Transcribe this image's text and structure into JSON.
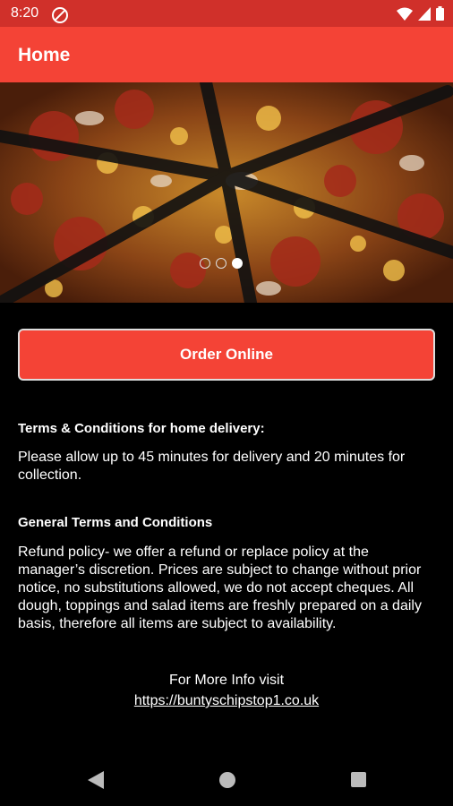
{
  "status_bar": {
    "time": "8:20",
    "icons": [
      "do-not-disturb-icon",
      "wifi-icon",
      "signal-icon",
      "battery-icon"
    ]
  },
  "app_bar": {
    "title": "Home"
  },
  "carousel": {
    "image": "pizza-photo",
    "pages": 3,
    "active_index": 2
  },
  "order_button": {
    "label": "Order Online"
  },
  "terms_delivery": {
    "heading": "Terms & Conditions for home delivery:",
    "body": "Please allow up to 45 minutes for delivery and 20 minutes for collection."
  },
  "general_terms": {
    "heading": "General Terms and Conditions",
    "body": "Refund policy- we offer a refund or replace policy at the manager’s discretion. Prices are subject to change without prior notice, no substitutions allowed, we do not accept cheques. All dough, toppings and salad items are freshly prepared on a daily basis, therefore all items are subject to availability."
  },
  "more_info": {
    "label": "For More Info visit",
    "link": "https://buntyschipstop1.co.uk"
  },
  "nav": [
    "back-icon",
    "home-icon",
    "recents-icon"
  ],
  "colors": {
    "app_bar": "#f44336",
    "status_bar": "#d0302a",
    "background": "#000000"
  }
}
